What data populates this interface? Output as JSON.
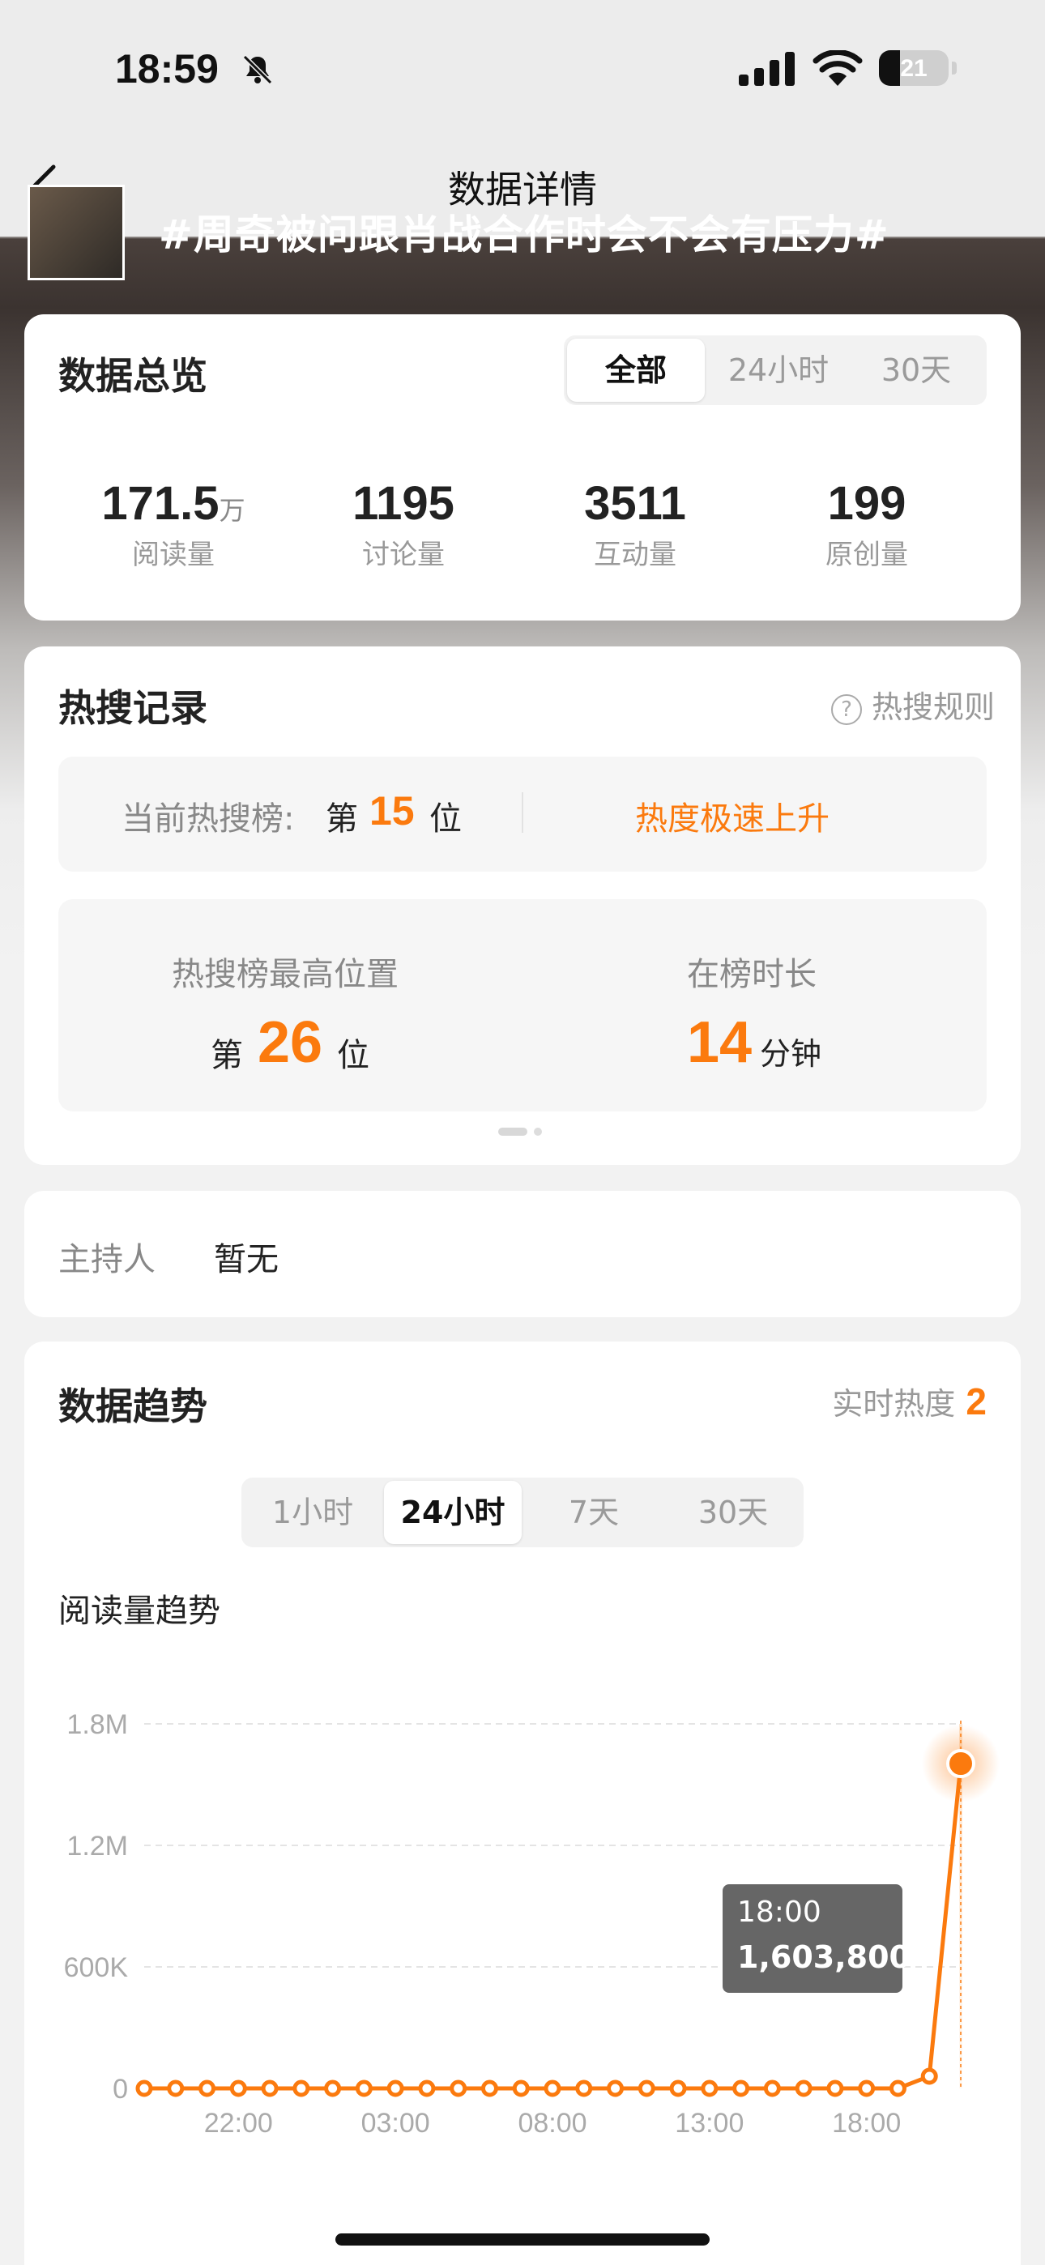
{
  "status_bar": {
    "time": "18:59",
    "battery": "21"
  },
  "header": {
    "title": "数据详情",
    "topic": "#周奇被问跟肖战合作时会不会有压力#"
  },
  "overview": {
    "title": "数据总览",
    "tabs": [
      "全部",
      "24小时",
      "30天"
    ],
    "selected_tab": "全部",
    "stats": [
      {
        "value": "171.5",
        "unit": "万",
        "label": "阅读量"
      },
      {
        "value": "1195",
        "unit": "",
        "label": "讨论量"
      },
      {
        "value": "3511",
        "unit": "",
        "label": "互动量"
      },
      {
        "value": "199",
        "unit": "",
        "label": "原创量"
      }
    ]
  },
  "hot_search": {
    "title": "热搜记录",
    "rules": "热搜规则",
    "current_label": "当前热搜榜:",
    "current_prefix": "第",
    "current_rank": "15",
    "current_suffix": "位",
    "trend_text": "热度极速上升",
    "highest_label": "热搜榜最高位置",
    "highest_prefix": "第",
    "highest_rank": "26",
    "highest_suffix": "位",
    "duration_label": "在榜时长",
    "duration_value": "14",
    "duration_unit": "分钟"
  },
  "host": {
    "label": "主持人",
    "value": "暂无"
  },
  "trend": {
    "title": "数据趋势",
    "realtime_label": "实时热度",
    "realtime_value": "2",
    "tabs": [
      "1小时",
      "24小时",
      "7天",
      "30天"
    ],
    "selected_tab": "24小时",
    "chart_title": "阅读量趋势",
    "tooltip_time": "18:00",
    "tooltip_value": "1,603,800"
  },
  "colors": {
    "accent": "#fb7a0e",
    "card": "#ffffff",
    "tooltip": "#666666"
  },
  "chart_data": {
    "type": "line",
    "title": "阅读量趋势",
    "y_tick_labels": [
      "0",
      "600K",
      "1.2M",
      "1.8M"
    ],
    "ylim": [
      0,
      1800000
    ],
    "x_tick_labels": [
      "22:00",
      "03:00",
      "08:00",
      "13:00",
      "18:00"
    ],
    "x": [
      -3,
      -2,
      -1,
      0,
      1,
      2,
      3,
      4,
      5,
      6,
      7,
      8,
      9,
      10,
      11,
      12,
      13,
      14,
      15,
      16,
      17,
      18,
      19,
      20,
      21,
      22,
      23
    ],
    "values": [
      0,
      0,
      0,
      0,
      0,
      0,
      0,
      0,
      0,
      0,
      0,
      0,
      0,
      0,
      0,
      0,
      0,
      0,
      0,
      0,
      0,
      0,
      0,
      0,
      0,
      60000,
      1603800
    ],
    "grid": true,
    "highlight_index": 26
  }
}
